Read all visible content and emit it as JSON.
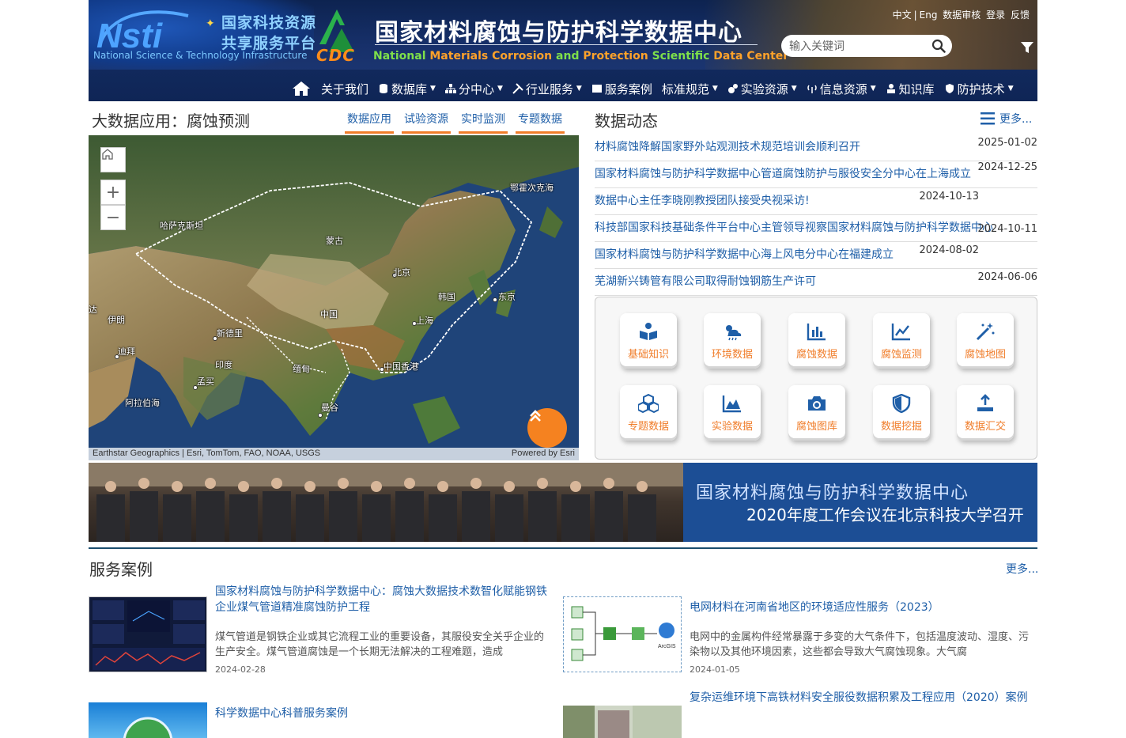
{
  "header": {
    "nsti_title_line1": "国家科技资源",
    "nsti_title_line2": "共享服务平台",
    "nsti_en": "National Science & Technology Infrastructure",
    "nsti_logo_text": "Nsti",
    "cdc_logo_text": "CDC",
    "site_title": "国家材料腐蚀与防护科学数据中心",
    "site_title_en_parts": [
      "National",
      " Materials",
      " Corrosion",
      " and",
      " Protection",
      " Scientific",
      " Data Center"
    ],
    "top_links": [
      "中文",
      "|",
      "Eng",
      "数据审核",
      "登录",
      "反馈"
    ],
    "search_placeholder": "输入关键词"
  },
  "nav": {
    "items": [
      {
        "label": "关于我们",
        "icon": "info-icon",
        "caret": false
      },
      {
        "label": "数据库",
        "icon": "database-icon",
        "caret": true
      },
      {
        "label": "分中心",
        "icon": "sitemap-icon",
        "caret": true
      },
      {
        "label": "行业服务",
        "icon": "tools-icon",
        "caret": true
      },
      {
        "label": "服务案例",
        "icon": "list-icon",
        "caret": false
      },
      {
        "label": "标准规范",
        "icon": "",
        "caret": true
      },
      {
        "label": "实验资源",
        "icon": "cogs-icon",
        "caret": true
      },
      {
        "label": "信息资源",
        "icon": "broadcast-icon",
        "caret": true
      },
      {
        "label": "知识库",
        "icon": "user-book-icon",
        "caret": false
      },
      {
        "label": "防护技术",
        "icon": "shield-icon",
        "caret": true
      }
    ]
  },
  "left": {
    "title": "大数据应用：腐蚀预测",
    "tabs": [
      "数据应用",
      "试验资源",
      "实时监测",
      "专题数据"
    ],
    "map_credit_left": "Earthstar Geographics | Esri, TomTom, FAO, NOAA, USGS",
    "map_credit_right": "Powered by Esri",
    "map_labels": [
      "鄂霍次克海",
      "哈萨克斯坦",
      "蒙古",
      "北京",
      "韩国",
      "东京",
      "中国",
      "上海",
      "新德里",
      "迪拜",
      "印度",
      "缅甸",
      "中国香港",
      "孟买",
      "曼谷",
      "阿拉伯海",
      "伊朗",
      "达"
    ]
  },
  "news": {
    "title": "数据动态",
    "more": "更多...",
    "items": [
      {
        "title": "材料腐蚀降解国家野外站观测技术规范培训会顺利召开",
        "date": "2025-01-02"
      },
      {
        "title": "国家材料腐蚀与防护科学数据中心管道腐蚀防护与服役安全分中心在上海成立",
        "date": "2024-12-25"
      },
      {
        "title": "数据中心主任李晓刚教授团队接受央视采访!",
        "date": "2024-10-13"
      },
      {
        "title": "科技部国家科技基础条件平台中心主管领导视察国家材料腐蚀与防护科学数据中心",
        "date": "2024-10-11"
      },
      {
        "title": "国家材料腐蚀与防护科学数据中心海上风电分中心在福建成立",
        "date": "2024-08-02"
      },
      {
        "title": "芜湖新兴铸管有限公司取得耐蚀钢筋生产许可",
        "date": "2024-06-06"
      }
    ]
  },
  "quick_links": [
    {
      "label": "基础知识",
      "icon": "book-reader-icon"
    },
    {
      "label": "环境数据",
      "icon": "weather-icon"
    },
    {
      "label": "腐蚀数据",
      "icon": "bar-chart-icon"
    },
    {
      "label": "腐蚀监测",
      "icon": "line-chart-icon"
    },
    {
      "label": "腐蚀地图",
      "icon": "magic-wand-icon"
    },
    {
      "label": "专题数据",
      "icon": "cubes-icon"
    },
    {
      "label": "实验数据",
      "icon": "area-chart-icon"
    },
    {
      "label": "腐蚀图库",
      "icon": "camera-icon"
    },
    {
      "label": "数据挖掘",
      "icon": "shield-half-icon"
    },
    {
      "label": "数据汇交",
      "icon": "upload-icon"
    }
  ],
  "banner": {
    "line1": "国家材料腐蚀与防护科学数据中心",
    "line2": "2020年度工作会议在北京科技大学召开"
  },
  "cases": {
    "title": "服务案例",
    "more": "更多...",
    "items": [
      {
        "title": "国家材料腐蚀与防护科学数据中心：腐蚀大数据技术数智化赋能钢铁企业煤气管道精准腐蚀防护工程",
        "desc": "煤气管道是钢铁企业或其它流程工业的重要设备，其服役安全关乎企业的生产安全。煤气管道腐蚀是一个长期无法解决的工程难题，造成",
        "date": "2024-02-28"
      },
      {
        "title": "电网材料在河南省地区的环境适应性服务（2023）",
        "desc": "电网中的金属构件经常暴露于多变的大气条件下，包括温度波动、湿度、污染物以及其他环境因素，这些都会导致大气腐蚀现象。大气腐",
        "date": "2024-01-05",
        "thumb_label": "ArcGIS"
      },
      {
        "title": "科学数据中心科普服务案例",
        "desc": "",
        "date": ""
      },
      {
        "title": "复杂运维环境下高铁材料安全服役数据积累及工程应用（2020）案例",
        "desc": "",
        "date": ""
      }
    ]
  },
  "colors": {
    "accent_orange": "#f07d2a",
    "link_blue": "#1f5fa8",
    "header_navy": "#17306a"
  }
}
